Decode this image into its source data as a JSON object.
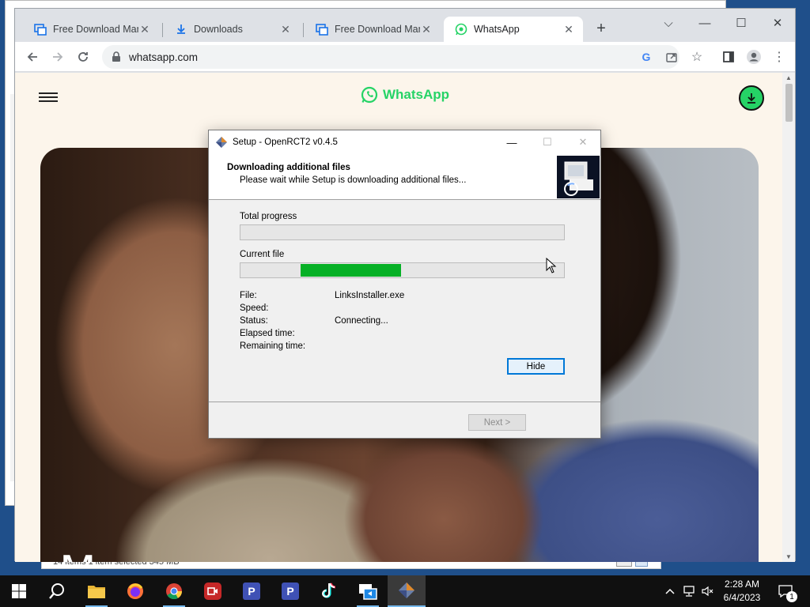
{
  "browser": {
    "tabs": [
      {
        "label": "Free Download Mana",
        "icon": "fdm-icon",
        "active": false
      },
      {
        "label": "Downloads",
        "icon": "download-icon",
        "active": false
      },
      {
        "label": "Free Download Mana",
        "icon": "fdm-icon",
        "active": false
      },
      {
        "label": "WhatsApp",
        "icon": "whatsapp-icon",
        "active": true
      }
    ],
    "url": "whatsapp.com"
  },
  "page": {
    "brand": "WhatsApp",
    "hero_text": "Message",
    "brand_color": "#25d366"
  },
  "background_window": {
    "status_text": "14 items    1 item selected  345 MB"
  },
  "dialog": {
    "title": "Setup - OpenRCT2 v0.4.5",
    "heading": "Downloading additional files",
    "subheading": "Please wait while Setup is downloading additional files...",
    "total_progress_label": "Total progress",
    "total_progress": 0,
    "current_file_label": "Current file",
    "current_progress_indeterminate": true,
    "fields": [
      {
        "label": "File:",
        "value": "LinksInstaller.exe"
      },
      {
        "label": "Speed:",
        "value": ""
      },
      {
        "label": "Status:",
        "value": "Connecting..."
      },
      {
        "label": "Elapsed time:",
        "value": ""
      },
      {
        "label": "Remaining time:",
        "value": ""
      }
    ],
    "hide_label": "Hide",
    "next_label": "Next >"
  },
  "taskbar": {
    "apps": [
      "start",
      "search",
      "file-explorer",
      "firefox",
      "chrome",
      "screen-recorder",
      "p-app-1",
      "p-app-2",
      "tiktok",
      "fdm",
      "openrct2-setup"
    ],
    "time": "2:28 AM",
    "date": "6/4/2023",
    "notification_count": "1",
    "accent": "#76b9ed"
  }
}
